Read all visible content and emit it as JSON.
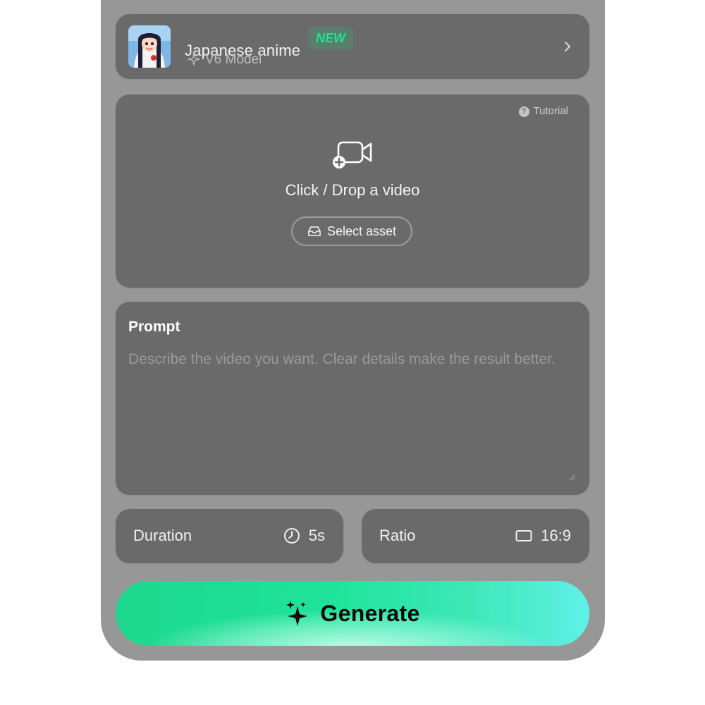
{
  "model": {
    "name": "Japanese anime",
    "badge": "NEW",
    "version": "V6 Model"
  },
  "upload": {
    "tutorial_label": "Tutorial",
    "drop_text": "Click / Drop a video",
    "select_asset_label": "Select asset"
  },
  "prompt": {
    "label": "Prompt",
    "placeholder": "Describe the video you want. Clear details make the result better.",
    "value": ""
  },
  "settings": {
    "duration_label": "Duration",
    "duration_value": "5s",
    "ratio_label": "Ratio",
    "ratio_value": "16:9"
  },
  "generate_label": "Generate",
  "colors": {
    "accent": "#1ee39a",
    "panel_bg": "#979797",
    "card_bg": "#6a6a6b"
  },
  "icons": {
    "thumbnail": "anime-girl-thumbnail",
    "version": "sparkle-icon",
    "chevron": "chevron-right-icon",
    "tutorial": "question-circle-icon",
    "upload": "video-add-icon",
    "asset": "inbox-tray-icon",
    "duration": "clock-icon",
    "ratio": "rectangle-ratio-icon",
    "generate": "sparkles-icon"
  }
}
